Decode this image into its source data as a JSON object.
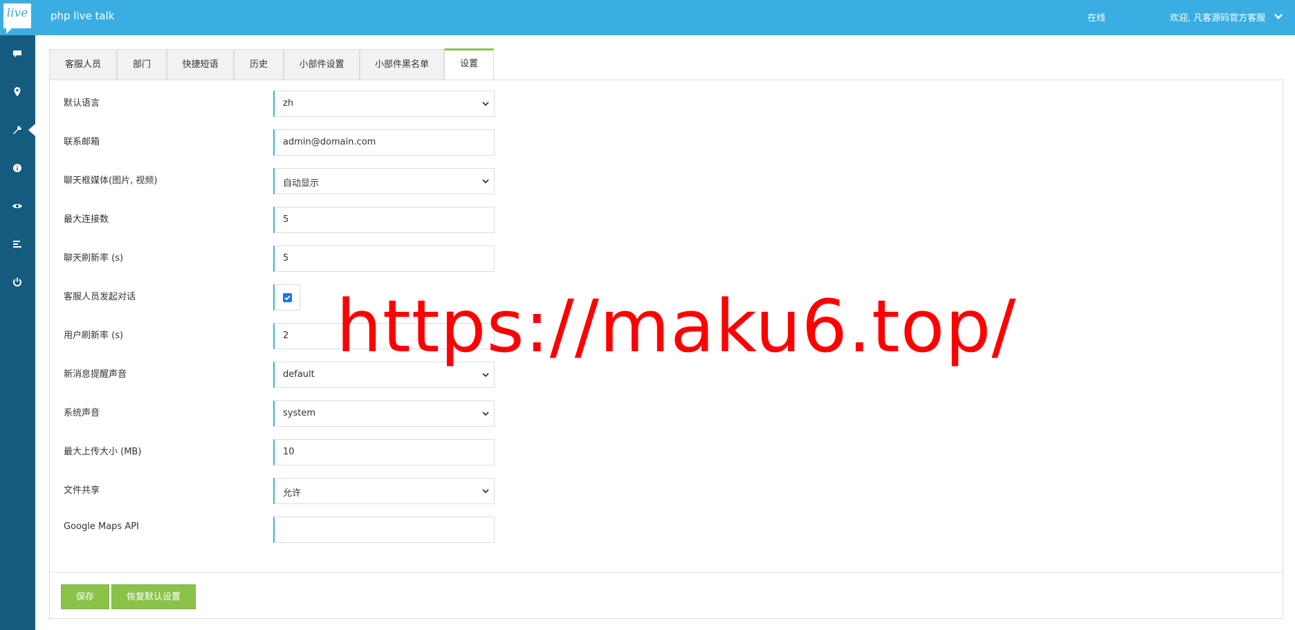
{
  "header": {
    "logo_text": "live",
    "app_title": "php live talk",
    "status": "在线",
    "welcome": "欢迎, 凡客源码官方客服"
  },
  "sidebar": {
    "items": [
      {
        "icon": "chat-icon"
      },
      {
        "icon": "map-marker-icon"
      },
      {
        "icon": "wrench-icon",
        "active": true
      },
      {
        "icon": "info-icon"
      },
      {
        "icon": "eye-icon"
      },
      {
        "icon": "list-icon"
      },
      {
        "icon": "power-icon"
      }
    ]
  },
  "tabs": [
    {
      "label": "客服人员"
    },
    {
      "label": "部门"
    },
    {
      "label": "快捷短语"
    },
    {
      "label": "历史"
    },
    {
      "label": "小部件设置"
    },
    {
      "label": "小部件黑名单"
    },
    {
      "label": "设置",
      "active": true
    }
  ],
  "settings": {
    "default_language": {
      "label": "默认语言",
      "value": "zh"
    },
    "contact_email": {
      "label": "联系邮箱",
      "value": "admin@domain.com"
    },
    "chat_media": {
      "label": "聊天框媒体(图片, 视频)",
      "value": "自动显示"
    },
    "max_connections": {
      "label": "最大连接数",
      "value": "5"
    },
    "chat_refresh": {
      "label": "聊天刷新率 (s)",
      "value": "5"
    },
    "agent_initiate": {
      "label": "客服人员发起对话",
      "checked": true
    },
    "user_refresh": {
      "label": "用户刷新率 (s)",
      "value": "2"
    },
    "new_message_sound": {
      "label": "新消息提醒声音",
      "value": "default"
    },
    "system_sound": {
      "label": "系统声音",
      "value": "system"
    },
    "max_upload": {
      "label": "最大上传大小 (MB)",
      "value": "10"
    },
    "file_sharing": {
      "label": "文件共享",
      "value": "允许"
    },
    "google_maps_api": {
      "label": "Google Maps API",
      "value": ""
    }
  },
  "buttons": {
    "save": "保存",
    "restore_defaults": "恢复默认设置"
  },
  "watermark": "https://maku6.top/",
  "colors": {
    "topbar": "#3aaee2",
    "sidebar": "#155b80",
    "accent_green": "#8bc34a",
    "watermark": "#ff0000"
  }
}
